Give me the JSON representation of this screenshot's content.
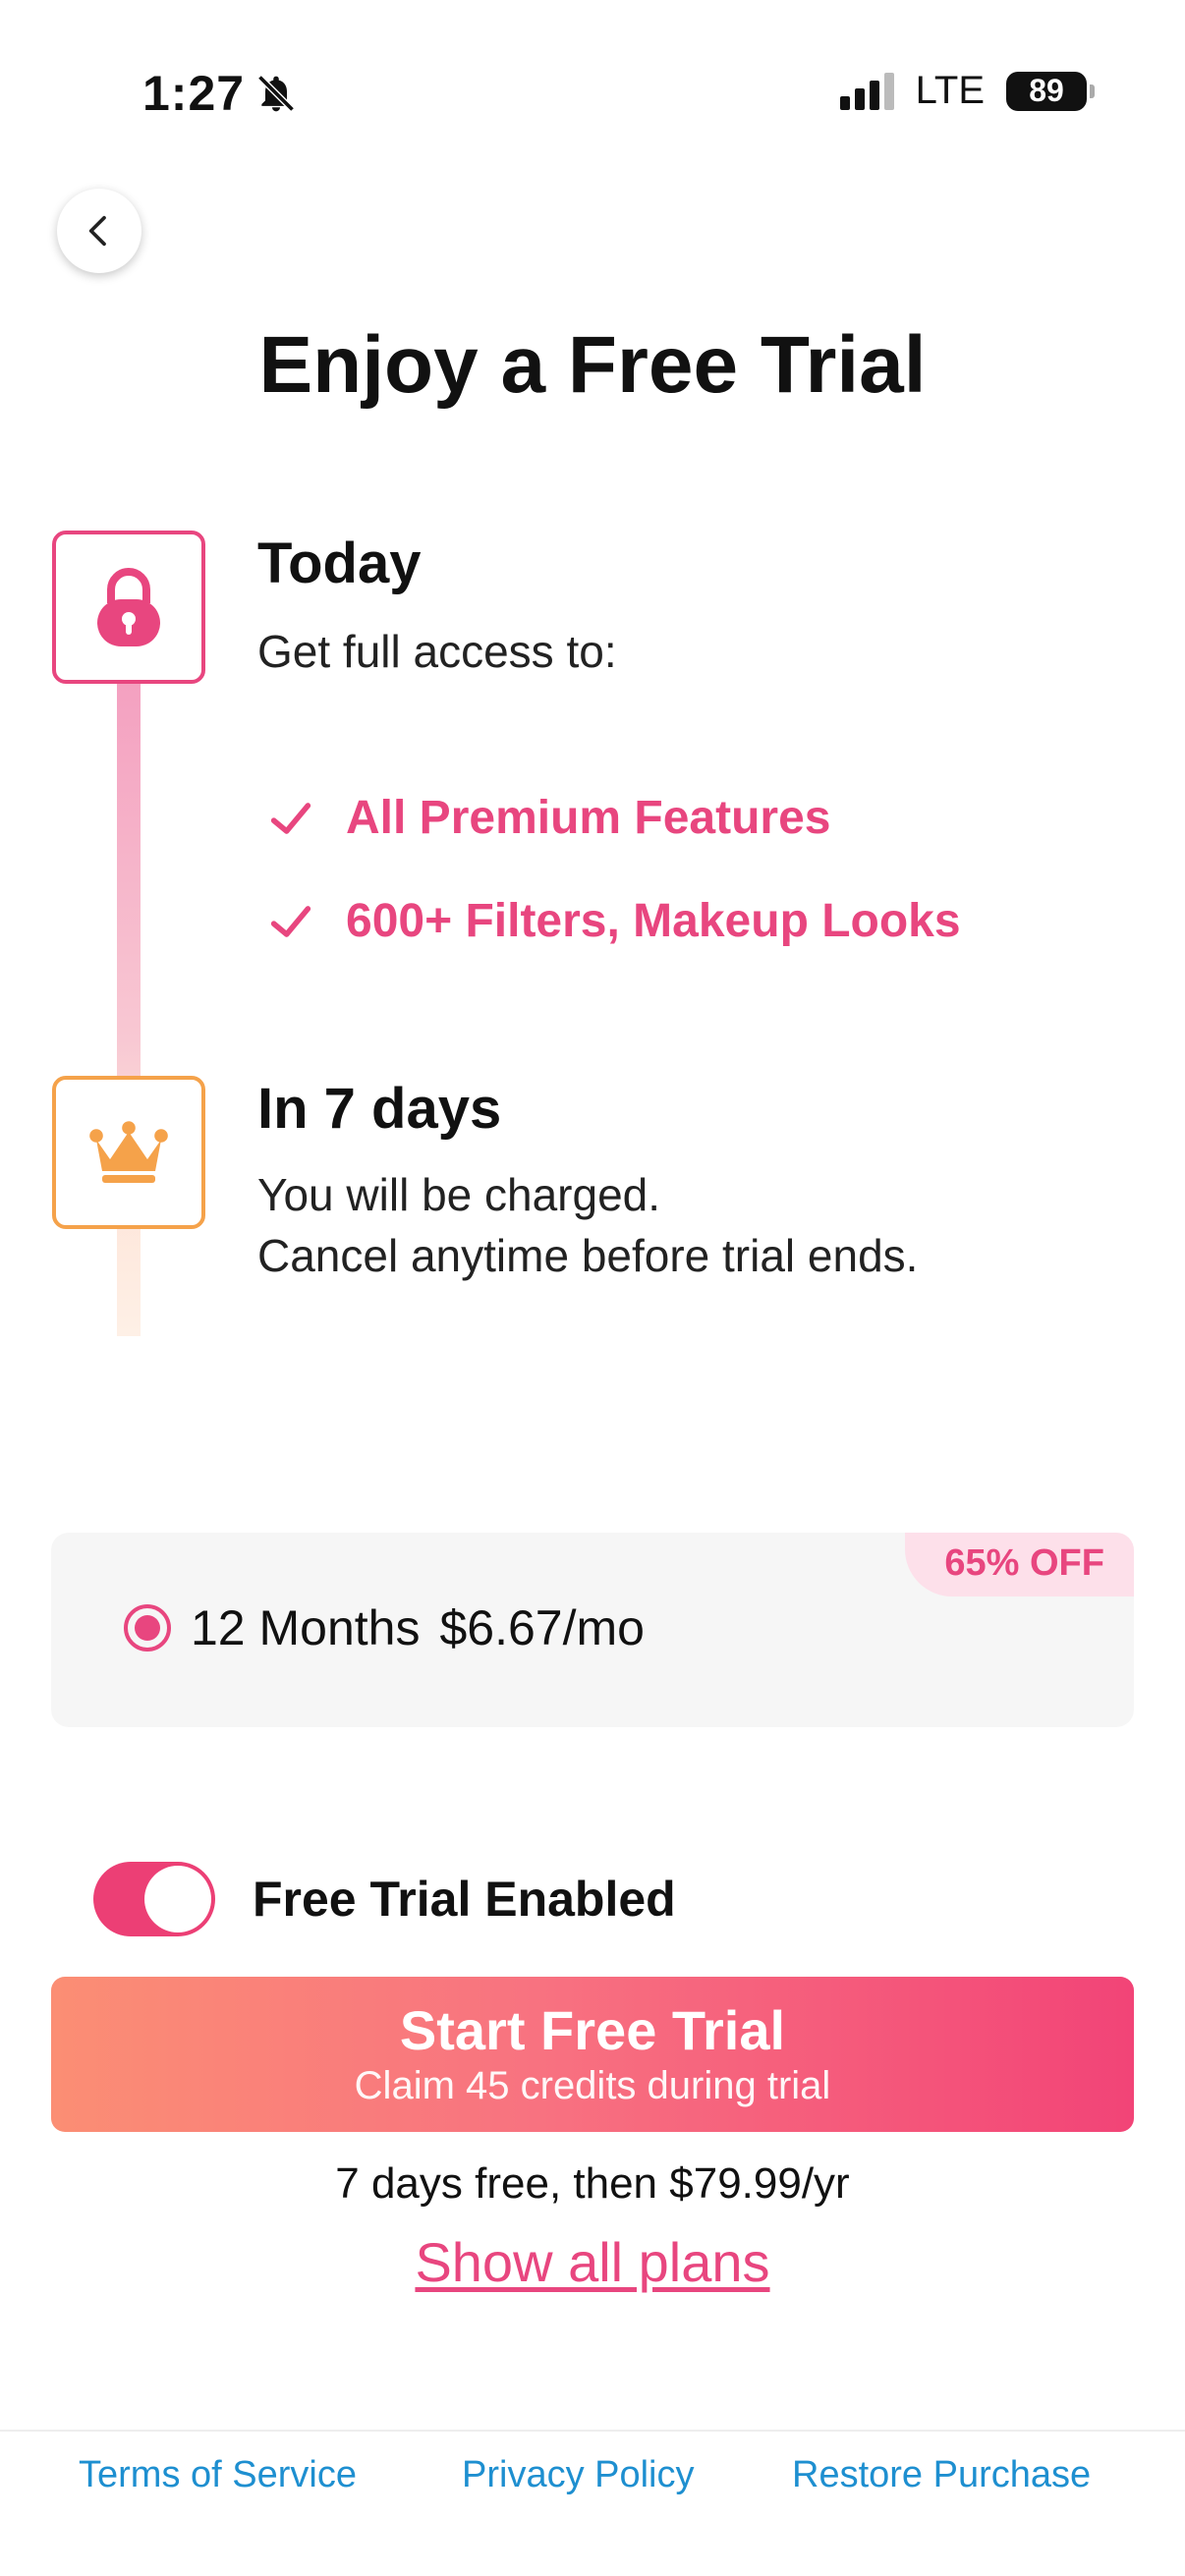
{
  "status_bar": {
    "time": "1:27",
    "network": "LTE",
    "battery": "89"
  },
  "header": {
    "title": "Enjoy a Free Trial"
  },
  "timeline": {
    "today": {
      "title": "Today",
      "subtitle": "Get full access to:",
      "features": [
        "All Premium Features",
        "600+ Filters, Makeup Looks"
      ]
    },
    "later": {
      "title": "In 7 days",
      "line1": "You will be charged.",
      "line2": "Cancel anytime before trial ends."
    }
  },
  "plan": {
    "name": "12 Months",
    "price": "$6.67/mo",
    "discount": "65% OFF",
    "selected": true
  },
  "toggle": {
    "label": "Free Trial Enabled",
    "enabled": true
  },
  "cta": {
    "label": "Start Free Trial",
    "sublabel": "Claim 45 credits during trial"
  },
  "price_note": "7 days free, then $79.99/yr",
  "show_plans": "Show all plans",
  "footer": {
    "terms": "Terms of Service",
    "privacy": "Privacy Policy",
    "restore": "Restore Purchase"
  },
  "colors": {
    "accent": "#e8467f",
    "crown": "#f5a24a",
    "link": "#1e8fd0"
  },
  "icons": {
    "back": "chevron-left-icon",
    "lock": "lock-icon",
    "crown": "crown-icon",
    "check": "check-icon",
    "mute": "bell-slash-icon"
  }
}
